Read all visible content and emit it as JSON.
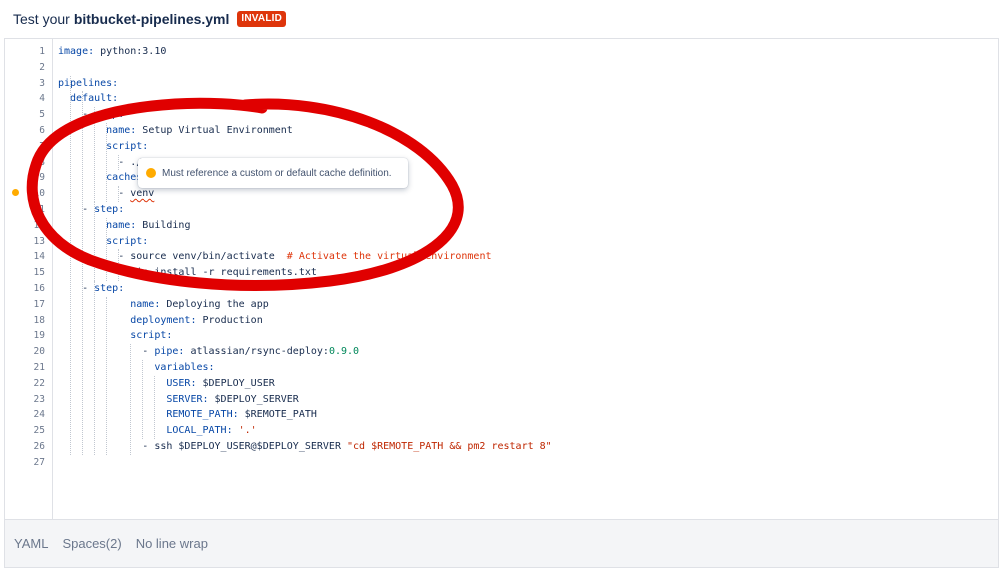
{
  "header": {
    "prefix": "Test your",
    "filename": "bitbucket-pipelines.yml",
    "status_badge": "INVALID"
  },
  "editor": {
    "lines": [
      {
        "n": "1",
        "tokens": [
          {
            "t": "image:",
            "c": "k"
          },
          {
            "t": " python:3.10",
            "c": "v"
          }
        ]
      },
      {
        "n": "2",
        "tokens": []
      },
      {
        "n": "3",
        "tokens": [
          {
            "t": "pipelines:",
            "c": "k"
          }
        ]
      },
      {
        "n": "4",
        "tokens": [
          {
            "t": "  default:",
            "c": "k"
          }
        ]
      },
      {
        "n": "5",
        "tokens": [
          {
            "t": "    - ",
            "c": "p"
          },
          {
            "t": "step:",
            "c": "k"
          }
        ]
      },
      {
        "n": "6",
        "tokens": [
          {
            "t": "        name:",
            "c": "k"
          },
          {
            "t": " Setup Virtual Environment",
            "c": "v"
          }
        ]
      },
      {
        "n": "7",
        "tokens": [
          {
            "t": "        script:",
            "c": "k"
          }
        ]
      },
      {
        "n": "8",
        "tokens": [
          {
            "t": "          - ./",
            "c": "v"
          }
        ]
      },
      {
        "n": "9",
        "tokens": [
          {
            "t": "        caches",
            "c": "k"
          }
        ]
      },
      {
        "n": "10",
        "tokens": [
          {
            "t": "          - ",
            "c": "v"
          },
          {
            "t": "venv",
            "c": "err"
          }
        ]
      },
      {
        "n": "11",
        "tokens": [
          {
            "t": "    - ",
            "c": "p"
          },
          {
            "t": "step:",
            "c": "k"
          }
        ]
      },
      {
        "n": "12",
        "tokens": [
          {
            "t": "        name:",
            "c": "k"
          },
          {
            "t": " Building",
            "c": "v"
          }
        ]
      },
      {
        "n": "13",
        "tokens": [
          {
            "t": "        script:",
            "c": "k"
          }
        ]
      },
      {
        "n": "14",
        "tokens": [
          {
            "t": "          - source venv/bin/activate  ",
            "c": "v"
          },
          {
            "t": "# Activate the virtual environment",
            "c": "c"
          }
        ]
      },
      {
        "n": "15",
        "tokens": [
          {
            "t": "            pip install -r requirements.txt",
            "c": "v"
          }
        ]
      },
      {
        "n": "16",
        "tokens": [
          {
            "t": "    - ",
            "c": "p"
          },
          {
            "t": "step:",
            "c": "k"
          }
        ]
      },
      {
        "n": "17",
        "tokens": [
          {
            "t": "            name:",
            "c": "k"
          },
          {
            "t": " Deploying the app",
            "c": "v"
          }
        ]
      },
      {
        "n": "18",
        "tokens": [
          {
            "t": "            deployment:",
            "c": "k"
          },
          {
            "t": " Production",
            "c": "v"
          }
        ]
      },
      {
        "n": "19",
        "tokens": [
          {
            "t": "            script:",
            "c": "k"
          }
        ]
      },
      {
        "n": "20",
        "tokens": [
          {
            "t": "              - ",
            "c": "v"
          },
          {
            "t": "pipe:",
            "c": "k"
          },
          {
            "t": " atlassian/rsync-deploy:",
            "c": "v"
          },
          {
            "t": "0.9.0",
            "c": "n"
          }
        ]
      },
      {
        "n": "21",
        "tokens": [
          {
            "t": "                variables:",
            "c": "k"
          }
        ]
      },
      {
        "n": "22",
        "tokens": [
          {
            "t": "                  USER:",
            "c": "k"
          },
          {
            "t": " $DEPLOY_USER",
            "c": "v"
          }
        ]
      },
      {
        "n": "23",
        "tokens": [
          {
            "t": "                  SERVER:",
            "c": "k"
          },
          {
            "t": " $DEPLOY_SERVER",
            "c": "v"
          }
        ]
      },
      {
        "n": "24",
        "tokens": [
          {
            "t": "                  REMOTE_PATH:",
            "c": "k"
          },
          {
            "t": " $REMOTE_PATH",
            "c": "v"
          }
        ]
      },
      {
        "n": "25",
        "tokens": [
          {
            "t": "                  LOCAL_PATH:",
            "c": "k"
          },
          {
            "t": " '.'",
            "c": "s"
          }
        ]
      },
      {
        "n": "26",
        "tokens": [
          {
            "t": "              - ssh $DEPLOY_USER@$DEPLOY_SERVER ",
            "c": "v"
          },
          {
            "t": "\"cd $REMOTE_PATH && pm2 restart 8\"",
            "c": "s"
          }
        ]
      },
      {
        "n": "27",
        "tokens": []
      }
    ],
    "warning_tooltip": "Must reference a custom or default cache definition."
  },
  "footer": {
    "language": "YAML",
    "indent": "Spaces(2)",
    "wrap": "No line wrap"
  },
  "colors": {
    "badge": "#de350b",
    "warning": "#ffab00",
    "annotation": "#e00000",
    "key": "#0747a6",
    "comment": "#de350b"
  }
}
